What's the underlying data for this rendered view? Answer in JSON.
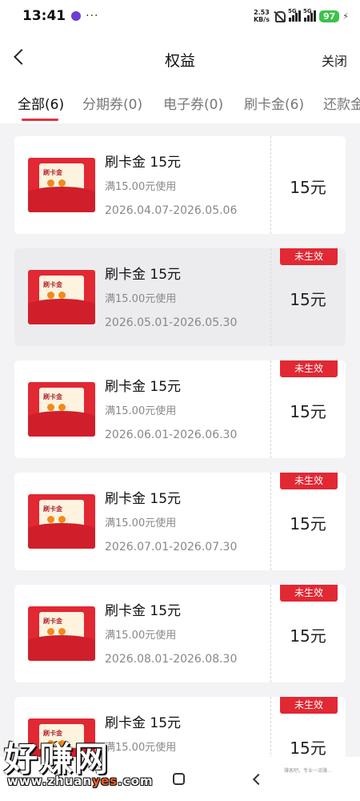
{
  "status_bar": {
    "time": "13:41",
    "more": "···",
    "net_speed_value": "2.53",
    "net_speed_unit": "KB/s",
    "sim1": "5G",
    "sim2": "5G",
    "battery": "97",
    "bolt": "⚡"
  },
  "header": {
    "title": "权益",
    "close_label": "关闭"
  },
  "tabs": [
    {
      "label": "全部(6)",
      "active": true
    },
    {
      "label": "分期券(0)",
      "active": false
    },
    {
      "label": "电子券(0)",
      "active": false
    },
    {
      "label": "刷卡金(6)",
      "active": false
    },
    {
      "label": "还款金",
      "active": false
    }
  ],
  "coupons": [
    {
      "thumb_text": "刷卡金",
      "title": "刷卡金 15元",
      "condition": "满15.00元使用",
      "date_range": "2026.04.07-2026.05.06",
      "value": "15元",
      "badge": ""
    },
    {
      "thumb_text": "刷卡金",
      "title": "刷卡金 15元",
      "condition": "满15.00元使用",
      "date_range": "2026.05.01-2026.05.30",
      "value": "15元",
      "badge": "未生效"
    },
    {
      "thumb_text": "刷卡金",
      "title": "刷卡金 15元",
      "condition": "满15.00元使用",
      "date_range": "2026.06.01-2026.06.30",
      "value": "15元",
      "badge": "未生效"
    },
    {
      "thumb_text": "刷卡金",
      "title": "刷卡金 15元",
      "condition": "满15.00元使用",
      "date_range": "2026.07.01-2026.07.30",
      "value": "15元",
      "badge": "未生效"
    },
    {
      "thumb_text": "刷卡金",
      "title": "刷卡金 15元",
      "condition": "满15.00元使用",
      "date_range": "2026.08.01-2026.08.30",
      "value": "15元",
      "badge": "未生效"
    },
    {
      "thumb_text": "刷卡金",
      "title": "刷卡金 15元",
      "condition": "满15.00元使用",
      "date_range": "",
      "value": "15元",
      "badge": "未生效"
    }
  ],
  "watermark": {
    "logo": "好赚网",
    "url_a": "www.zhuan",
    "url_b": "yes",
    "url_c": ".com",
    "small": "赚客吧，专业一流赚..."
  },
  "colors": {
    "accent": "#e12833",
    "tab_underline": "#e8303c",
    "battery": "#3cc24b"
  },
  "icons": [
    "back-arrow-icon",
    "mute-icon",
    "signal-icon",
    "battery-icon",
    "home-button-icon",
    "nav-back-icon"
  ]
}
